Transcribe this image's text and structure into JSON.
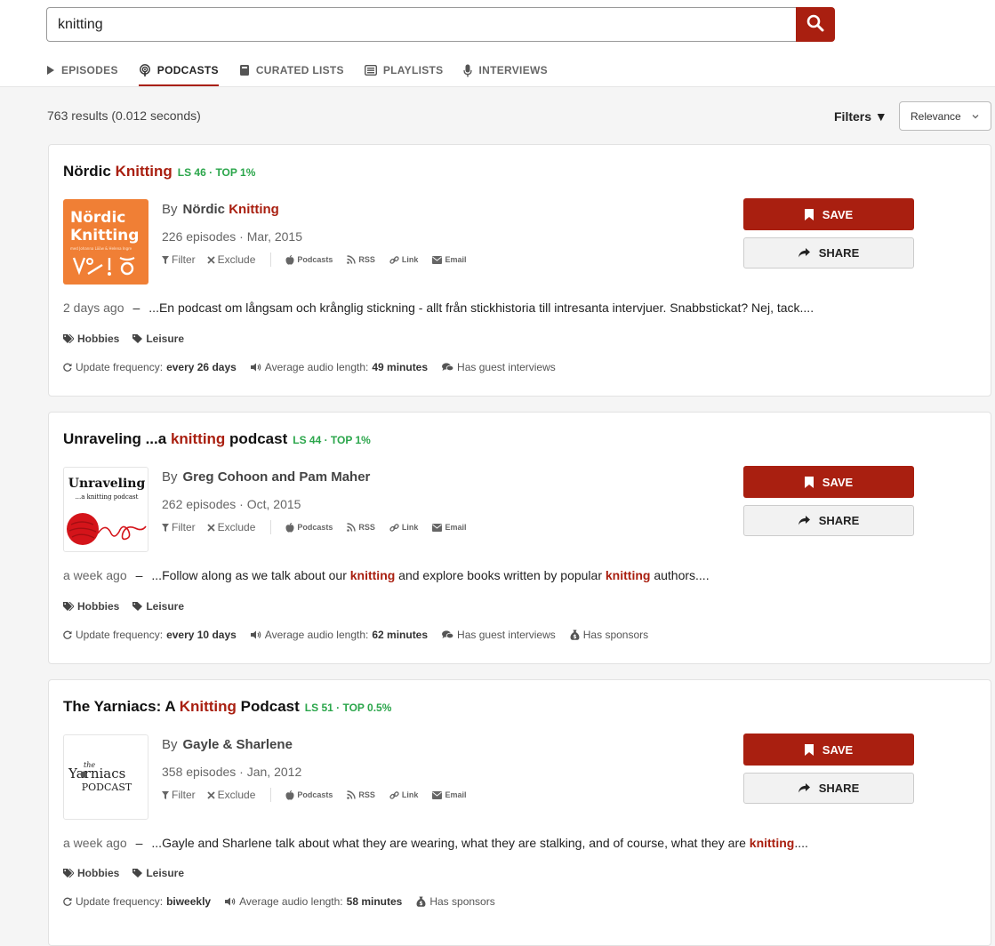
{
  "search": {
    "query": "knitting"
  },
  "tabs": [
    {
      "label": "EPISODES",
      "icon": "play-icon",
      "active": false
    },
    {
      "label": "PODCASTS",
      "icon": "podcast-icon",
      "active": true
    },
    {
      "label": "CURATED LISTS",
      "icon": "book-icon",
      "active": false
    },
    {
      "label": "PLAYLISTS",
      "icon": "list-icon",
      "active": false
    },
    {
      "label": "INTERVIEWS",
      "icon": "microphone-icon",
      "active": false
    }
  ],
  "results": {
    "summary": "763 results (0.012 seconds)",
    "filters_label": "Filters ▼",
    "sort_value": "Relevance"
  },
  "common": {
    "by": "By",
    "filter": "Filter",
    "exclude": "Exclude",
    "podcasts": "Podcasts",
    "rss": "RSS",
    "link": "Link",
    "email": "Email",
    "save": "SAVE",
    "share": "SHARE",
    "dash": "–",
    "update_frequency": "Update frequency:",
    "avg_audio": "Average audio length:",
    "guest": "Has guest interviews",
    "sponsors": "Has sponsors"
  },
  "colors": {
    "accent": "#a91f10",
    "score_green": "#2ba64b"
  },
  "cards": [
    {
      "title": {
        "pre": "Nördic ",
        "hl": "Knitting",
        "post": ""
      },
      "score": "LS 46 · TOP 1%",
      "author": {
        "pre": "Nördic ",
        "hl": "Knitting"
      },
      "episodes": "226 episodes · Mar, 2015",
      "description": {
        "when": "2 days ago",
        "parts": [
          "...En podcast om långsam och krånglig stickning - allt från stickhistoria till intresanta intervjuer. Snabbstickat? Nej, tack...."
        ]
      },
      "categories": [
        "Hobbies",
        "Leisure"
      ],
      "update_frequency": "every 26 days",
      "avg_audio": "49 minutes",
      "has_guest": true,
      "has_sponsors": false,
      "art": {
        "line1": "Nördic",
        "line2": "Knitting",
        "sub": "med Johanna Lööw & Helena Ingre"
      }
    },
    {
      "title": {
        "pre": "Unraveling ...a ",
        "hl": "knitting",
        "post": " podcast"
      },
      "score": "LS 44 · TOP 1%",
      "author": {
        "pre": "Greg Cohoon and Pam Maher",
        "hl": ""
      },
      "episodes": "262 episodes · Oct, 2015",
      "description": {
        "when": "a week ago",
        "parts": [
          "...Follow along as we talk about our ",
          "knitting",
          " and explore books written by popular ",
          "knitting",
          " authors...."
        ]
      },
      "categories": [
        "Hobbies",
        "Leisure"
      ],
      "update_frequency": "every 10 days",
      "avg_audio": "62 minutes",
      "has_guest": true,
      "has_sponsors": true,
      "art": {
        "line1": "Unraveling",
        "line2": "...a knitting podcast"
      }
    },
    {
      "title": {
        "pre": "The Yarniacs: A ",
        "hl": "Knitting",
        "post": " Podcast"
      },
      "score": "LS 51 · TOP 0.5%",
      "author": {
        "pre": "Gayle & Sharlene",
        "hl": ""
      },
      "episodes": "358 episodes · Jan, 2012",
      "description": {
        "when": "a week ago",
        "parts": [
          "...Gayle and Sharlene talk about what they are wearing, what they are stalking, and of course, what they are ",
          "knitting",
          "...."
        ]
      },
      "categories": [
        "Hobbies",
        "Leisure"
      ],
      "update_frequency": "biweekly",
      "avg_audio": "58 minutes",
      "has_guest": false,
      "has_sponsors": true,
      "art": {
        "line1": "the",
        "line2": "Yarniacs",
        "line3": "PODCAST"
      }
    }
  ]
}
